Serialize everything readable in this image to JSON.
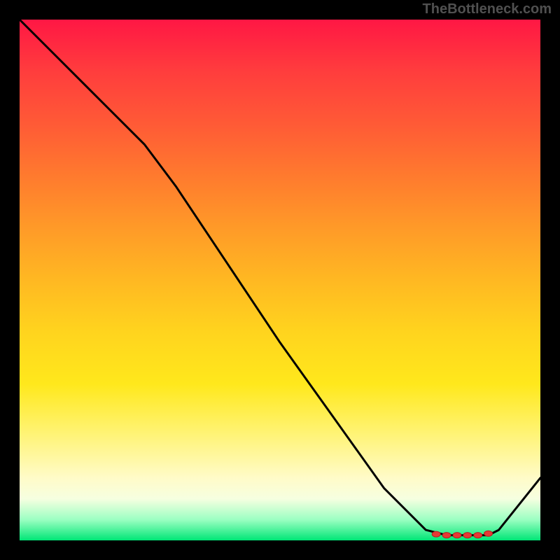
{
  "watermark": "TheBottleneck.com",
  "chart_data": {
    "type": "line",
    "title": "",
    "xlabel": "",
    "ylabel": "",
    "xlim": [
      0,
      100
    ],
    "ylim": [
      0,
      100
    ],
    "grid": false,
    "series": [
      {
        "name": "curve",
        "x": [
          0,
          8,
          16,
          24,
          30,
          40,
          50,
          60,
          70,
          78,
          82,
          85,
          88,
          90,
          92,
          100
        ],
        "values": [
          100,
          92,
          84,
          76,
          68,
          53,
          38,
          24,
          10,
          2,
          1,
          1,
          1,
          1,
          2,
          12
        ]
      }
    ],
    "markers": {
      "x": [
        80,
        82,
        84,
        86,
        88,
        90
      ],
      "values": [
        1.2,
        1.0,
        1.0,
        1.0,
        1.0,
        1.3
      ]
    },
    "colors": {
      "line": "#000000",
      "marker_fill": "#e53935",
      "marker_stroke": "#b71c1c"
    }
  }
}
